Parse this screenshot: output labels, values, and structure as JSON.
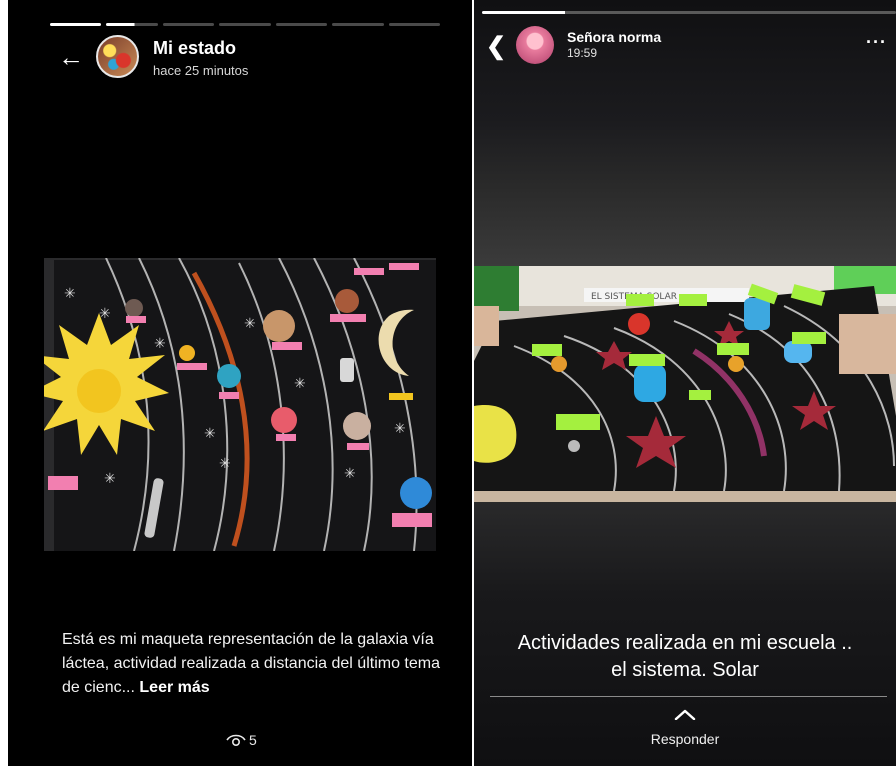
{
  "left_story": {
    "progress_segments": 7,
    "progress_done": 1,
    "back_icon": "arrow-left-icon",
    "title": "Mi estado",
    "time": "hace 25 minutos",
    "caption": "Está es mi maqueta representación de la galaxia vía láctea, actividad realizada a distancia del último tema de cienc...",
    "read_more": "Leer más",
    "views_icon": "eye-icon",
    "views_count": "5"
  },
  "right_story": {
    "progress_fraction": 0.2,
    "back_icon": "chevron-left-icon",
    "user_name": "Señora norma",
    "time": "19:59",
    "more_icon": "more-horizontal-icon",
    "photo_label": "EL SISTEMA SOLAR",
    "caption_line1": "Actividades realizada en mi escuela ..",
    "caption_line2": "el sistema. Solar",
    "reply_icon": "chevron-up-icon",
    "reply_label": "Responder"
  }
}
